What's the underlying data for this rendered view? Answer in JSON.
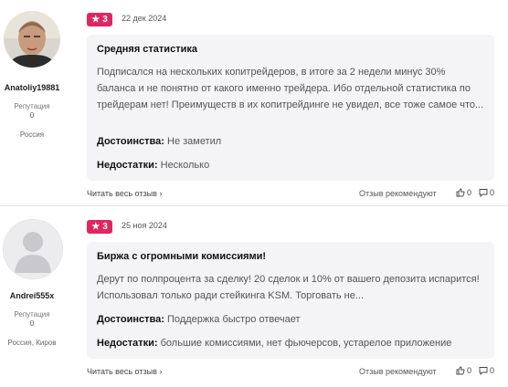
{
  "reviews": [
    {
      "author": {
        "name": "Anatoliy19881",
        "reputation_label": "Репутация",
        "reputation": "0",
        "country": "Россия"
      },
      "rating": "3",
      "date": "22 дек 2024",
      "title": "Средняя статистика",
      "text": "Подписался на нескольких копитрейдеров, в итоге за 2 недели минус 30% баланса и не понятно от какого именно трейдера. Ибо отдельной статистика по трейдерам нет! Преимуществ в их копитрейдинге не увидел, все тоже самое что...",
      "pros_label": "Достоинства:",
      "pros": "Не заметил",
      "cons_label": "Недостатки:",
      "cons": "Несколько",
      "read_more": "Читать весь отзыв",
      "recommend_label": "Отзыв рекомендуют",
      "likes": "0",
      "comments": "0"
    },
    {
      "author": {
        "name": "Andrei555x",
        "reputation_label": "Репутация",
        "reputation": "0",
        "country": "Россия, Киров"
      },
      "rating": "3",
      "date": "25 ноя 2024",
      "title": "Биржа с огромными комиссиями!",
      "text": "Дерут по полпроцента за сделку! 20 сделок и 10% от вашего депозита испарится! Использовал только ради стейкинга KSM. Торговать не...",
      "pros_label": "Достоинства:",
      "pros": "Поддержка быстро отвечает",
      "cons_label": "Недостатки:",
      "cons": "большие комиссиями, нет фьючерсов, устарелое приложение",
      "read_more": "Читать весь отзыв",
      "recommend_label": "Отзыв рекомендуют",
      "likes": "0",
      "comments": "0"
    }
  ],
  "colors": {
    "accent": "#e02660",
    "card_bg": "#f4f4f6"
  }
}
